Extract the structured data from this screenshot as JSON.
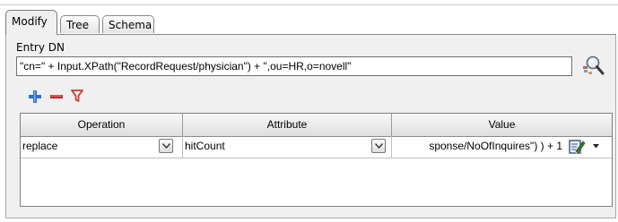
{
  "tabs": [
    {
      "label": "Modify",
      "active": true
    },
    {
      "label": "Tree",
      "active": false
    },
    {
      "label": "Schema",
      "active": false
    }
  ],
  "entry_dn": {
    "label": "Entry DN",
    "value": "\"cn=\" + Input.XPath(\"RecordRequest/physician\") + \",ou=HR,o=novell\""
  },
  "icons": {
    "lookup": "dn-lookup-magnifier-icon",
    "add": "plus-icon",
    "remove": "minus-icon",
    "filter": "filter-funnel-icon",
    "edit": "edit-expression-icon"
  },
  "grid": {
    "columns": [
      "Operation",
      "Attribute",
      "Value"
    ],
    "rows": [
      {
        "operation": "replace",
        "attribute": "hitCount",
        "value": "sponse/NoOfInquires\") ) + 1"
      }
    ]
  },
  "colors": {
    "add_icon": "#2f6fcf",
    "remove_icon": "#c2262a",
    "filter_icon": "#c63c2c",
    "panel_background": "#f0f0f0"
  }
}
